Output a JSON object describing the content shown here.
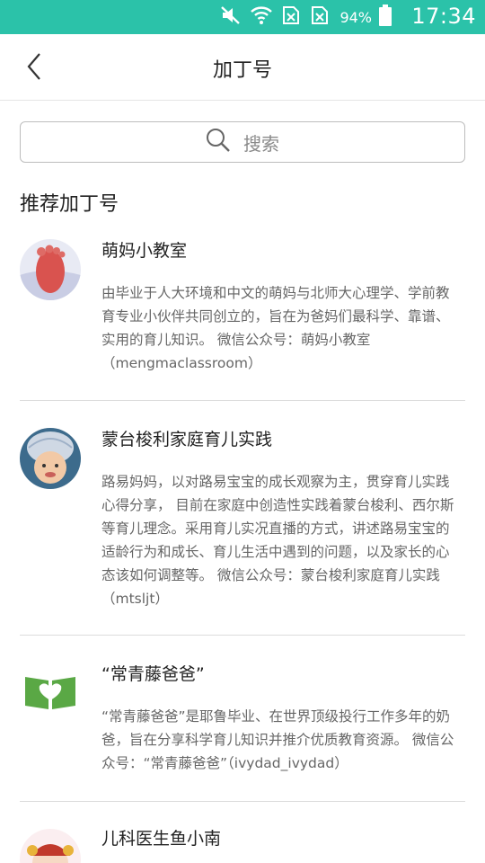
{
  "status_bar": {
    "battery_percent": "94%",
    "time": "17:34",
    "icons": [
      "mute-icon",
      "wifi-icon",
      "sim-off-icon",
      "sim-off-icon",
      "battery-icon"
    ]
  },
  "nav": {
    "title": "加丁号",
    "back_icon": "chevron-left-icon"
  },
  "search": {
    "placeholder": "搜索",
    "icon": "search-icon"
  },
  "section_title": "推荐加丁号",
  "items": [
    {
      "title": "萌妈小教室",
      "desc": "由毕业于人大环境和中文的萌妈与北师大心理学、学前教育专业小伙伴共同创立的，旨在为爸妈们最科学、靠谱、实用的育儿知识。 微信公众号：萌妈小教室（mengmaclassroom）"
    },
    {
      "title": "蒙台梭利家庭育儿实践",
      "desc": "路易妈妈，以对路易宝宝的成长观察为主，贯穿育儿实践心得分享， 目前在家庭中创造性实践着蒙台梭利、西尔斯等育儿理念。采用育儿实况直播的方式，讲述路易宝宝的适龄行为和成长、育儿生活中遇到的问题，以及家长的心态该如何调整等。 微信公众号：蒙台梭利家庭育儿实践（mtsljt）"
    },
    {
      "title": "“常青藤爸爸”",
      "desc": "“常青藤爸爸”是耶鲁毕业、在世界顶级投行工作多年的奶爸，旨在分享科学育儿知识并推介优质教育资源。 微信公众号：“常青藤爸爸”（ivydad_ivydad）"
    },
    {
      "title": "儿科医生鱼小南",
      "desc": ""
    }
  ]
}
